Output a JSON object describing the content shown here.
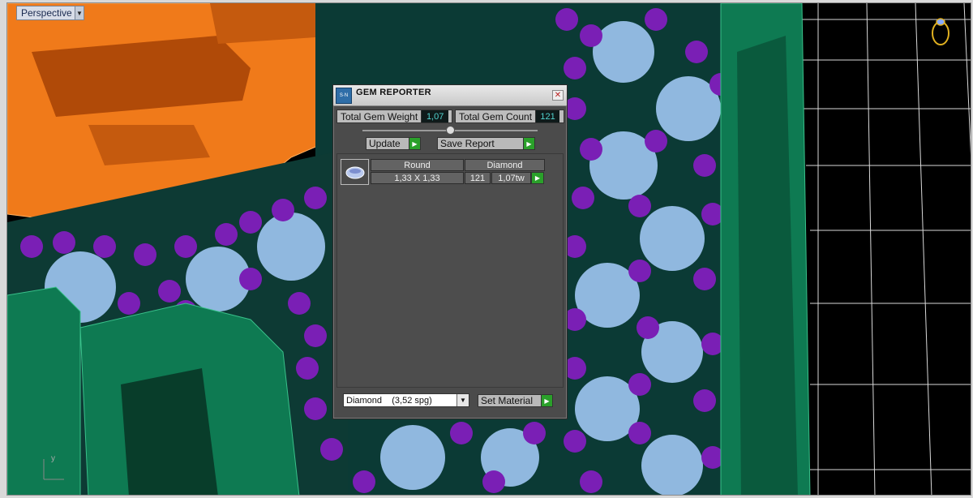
{
  "viewport": {
    "view_name": "Perspective",
    "colors": {
      "background": "#000000",
      "grid": "#ffffff",
      "prongs": "#7a1fb5",
      "gems": "#9fc6f2",
      "shank": "#0e7a52",
      "orange_part": "#f07a1a"
    },
    "icons": {
      "ring": "ring-icon",
      "axis": "axis-icon",
      "dropdown": "chevron-down-icon"
    }
  },
  "gem_reporter": {
    "title": "GEM REPORTER",
    "logo_text": "S·N",
    "close_label": "✕",
    "total_weight_label": "Total Gem Weight",
    "total_weight_value": "1,07",
    "total_count_label": "Total Gem Count",
    "total_count_value": "121",
    "update_label": "Update",
    "save_report_label": "Save Report",
    "gems": [
      {
        "shape": "Round",
        "material": "Diamond",
        "size": "1,33 X 1,33",
        "count": "121",
        "weight": "1,07tw"
      }
    ],
    "material_select": "Diamond    (3,52 spg)",
    "set_material_label": "Set Material"
  }
}
